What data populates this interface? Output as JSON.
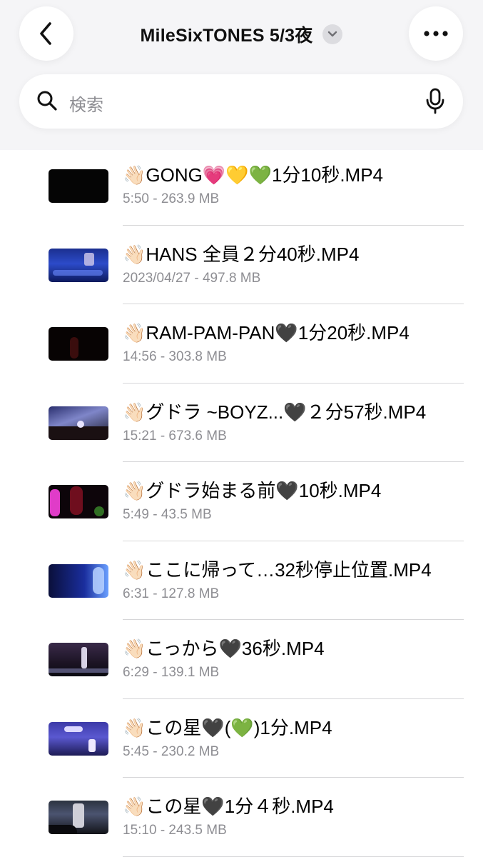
{
  "header": {
    "title": "MileSixTONES 5/3夜"
  },
  "search": {
    "placeholder": "検索"
  },
  "files": [
    {
      "title": "👋🏻GONG💗💛💚1分10秒.MP4",
      "meta": "5:50 - 263.9 MB",
      "thumb": "black"
    },
    {
      "title": "👋🏻HANS 全員２分40秒.MP4",
      "meta": "2023/04/27 - 497.8 MB",
      "thumb": "stage-blue"
    },
    {
      "title": "👋🏻RAM-PAM-PAN🖤1分20秒.MP4",
      "meta": "14:56 - 303.8 MB",
      "thumb": "dark-red"
    },
    {
      "title": "👋🏻グドラ ~BOYZ...🖤２分57秒.MP4",
      "meta": "15:21 - 673.6 MB",
      "thumb": "stage-lights"
    },
    {
      "title": "👋🏻グドラ始まる前🖤10秒.MP4",
      "meta": "5:49 - 43.5 MB",
      "thumb": "magenta"
    },
    {
      "title": "👋🏻ここに帰って…32秒停止位置.MP4",
      "meta": "6:31 - 127.8 MB",
      "thumb": "blue-glow"
    },
    {
      "title": "👋🏻こっから🖤36秒.MP4",
      "meta": "6:29 - 139.1 MB",
      "thumb": "stage-dark"
    },
    {
      "title": "👋🏻この星🖤(💚)1分.MP4",
      "meta": "5:45 - 230.2 MB",
      "thumb": "stage-purple"
    },
    {
      "title": "👋🏻この星🖤1分４秒.MP4",
      "meta": "15:10 - 243.5 MB",
      "thumb": "stage-night"
    }
  ],
  "colors": {
    "bar_background": "#f5f5f7",
    "text_primary": "#000000",
    "text_secondary": "#8e8e93",
    "divider": "#d6d6d8"
  }
}
